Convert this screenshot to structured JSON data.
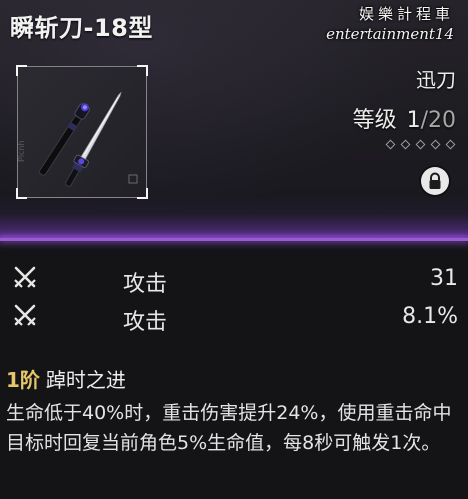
{
  "header": {
    "weapon_name": "瞬斩刀-18型",
    "watermark_cn": "娱樂計程車",
    "watermark_en": "entertainment14",
    "weapon_type": "迅刀",
    "level_label": "等级",
    "level_current": "1",
    "level_max": "/20",
    "rank_slots_total": 5,
    "rank_slots_filled": 0,
    "lock_icon": "lock-icon",
    "frame_side_text": "Plcnh"
  },
  "stats": [
    {
      "icon": "crossed-swords-icon",
      "name": "攻击",
      "value": "31"
    },
    {
      "icon": "crossed-swords-icon",
      "name": "攻击",
      "value": "8.1%"
    }
  ],
  "passive": {
    "rank": "1阶",
    "name": "踔时之进",
    "description": "生命低于40%时，重击伤害提升24%，使用重击命中目标时回复当前角色5%生命值，每8秒可触发1次。"
  },
  "colors": {
    "accent_purple": "#9a5ad8",
    "rank_gold": "#e6c66a",
    "text": "#e9e9e9"
  }
}
